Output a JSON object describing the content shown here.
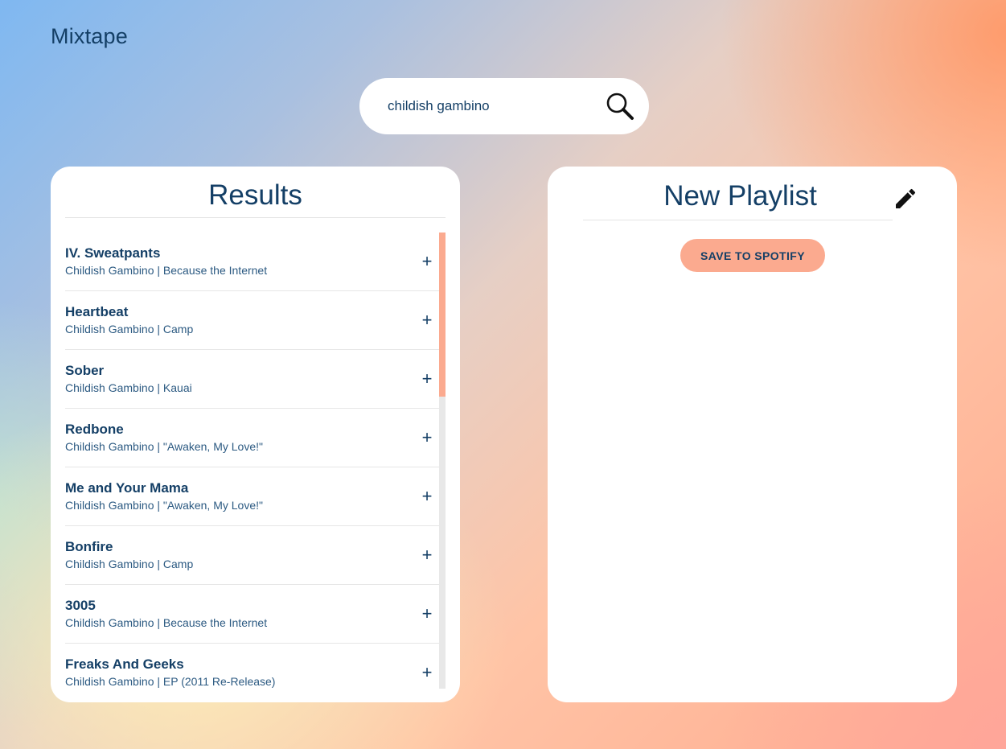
{
  "app": {
    "title": "Mixtape"
  },
  "search": {
    "value": "childish gambino",
    "icon": "search-icon"
  },
  "results": {
    "title": "Results",
    "add_label": "+",
    "tracks": [
      {
        "name": "IV. Sweatpants",
        "meta": "Childish Gambino | Because the Internet"
      },
      {
        "name": "Heartbeat",
        "meta": "Childish Gambino | Camp"
      },
      {
        "name": "Sober",
        "meta": "Childish Gambino | Kauai"
      },
      {
        "name": "Redbone",
        "meta": "Childish Gambino | \"Awaken, My Love!\""
      },
      {
        "name": "Me and Your Mama",
        "meta": "Childish Gambino | \"Awaken, My Love!\""
      },
      {
        "name": "Bonfire",
        "meta": "Childish Gambino | Camp"
      },
      {
        "name": "3005",
        "meta": "Childish Gambino | Because the Internet"
      },
      {
        "name": "Freaks And Geeks",
        "meta": "Childish Gambino | EP (2011 Re-Release)"
      }
    ]
  },
  "playlist": {
    "name": "New Playlist",
    "edit_icon": "pencil-icon",
    "save_label": "SAVE TO SPOTIFY"
  },
  "colors": {
    "text": "#143f66",
    "accent": "#fbaa8f",
    "panel": "#ffffff"
  }
}
